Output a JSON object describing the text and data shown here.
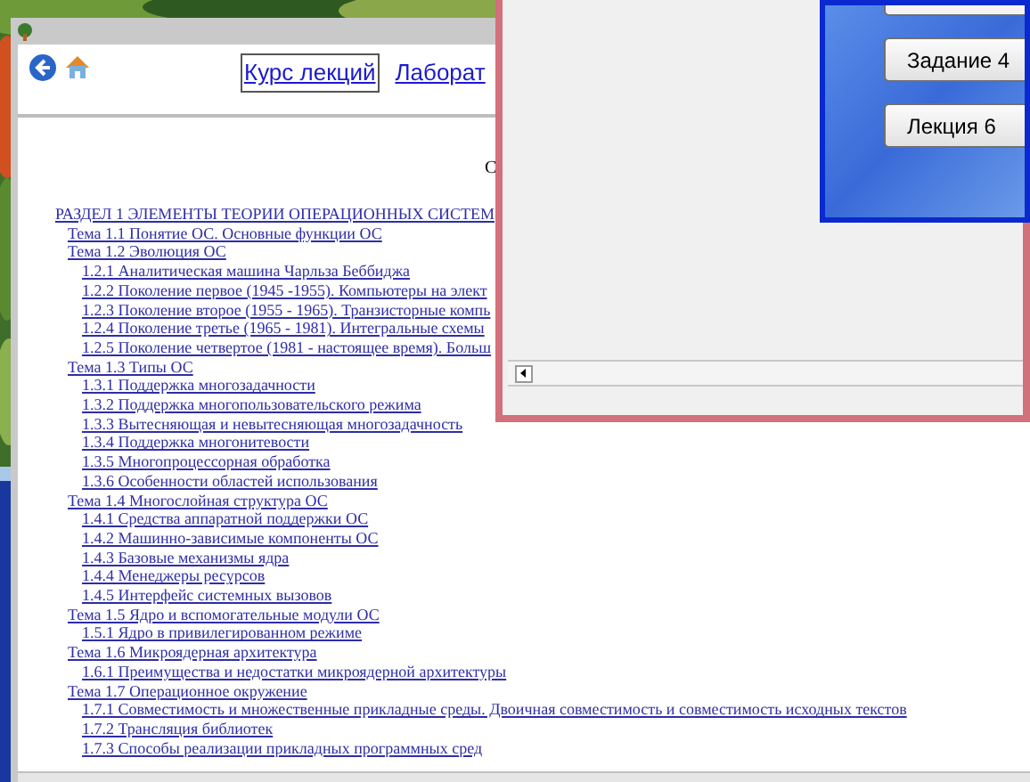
{
  "browser_window": {
    "nav_links": [
      {
        "label": "Курс лекций",
        "selected": true
      },
      {
        "label": "Лаборат",
        "selected": false
      }
    ],
    "heading": "С",
    "contents": [
      {
        "text": "РАЗДЕЛ 1 ЭЛЕМЕНТЫ ТЕОРИИ ОПЕРАЦИОННЫХ СИСТЕМ",
        "children": [
          {
            "text": "Тема 1.1 Понятие ОС. Основные функции ОС"
          },
          {
            "text": "Тема 1.2 Эволюция ОС",
            "children": [
              {
                "text": "1.2.1 Аналитическая машина Чарльза Беббиджа"
              },
              {
                "text": "1.2.2 Поколение первое (1945 -1955). Компьютеры на элект"
              },
              {
                "text": "1.2.3 Поколение второе (1955 - 1965). Транзисторные компь"
              },
              {
                "text": "1.2.4 Поколение третье (1965 - 1981). Интегральные схемы"
              },
              {
                "text": "1.2.5 Поколение четвертое (1981 - настоящее время). Больш"
              }
            ]
          },
          {
            "text": "Тема 1.3 Типы ОС",
            "children": [
              {
                "text": "1.3.1 Поддержка многозадачности"
              },
              {
                "text": "1.3.2 Поддержка многопользовательского режима"
              },
              {
                "text": "1.3.3 Вытесняющая и невытесняющая многозадачность"
              },
              {
                "text": "1.3.4 Поддержка многонитевости"
              },
              {
                "text": "1.3.5 Многопроцессорная обработка"
              },
              {
                "text": "1.3.6 Особенности областей использования"
              }
            ]
          },
          {
            "text": "Тема 1.4 Многослойная структура ОС",
            "children": [
              {
                "text": "1.4.1 Средства аппаратной поддержки ОС"
              },
              {
                "text": "1.4.2 Машинно-зависимые компоненты ОС"
              },
              {
                "text": "1.4.3 Базовые механизмы ядра"
              },
              {
                "text": "1.4.4 Менеджеры ресурсов"
              },
              {
                "text": "1.4.5 Интерфейс системных вызовов"
              }
            ]
          },
          {
            "text": "Тема 1.5 Ядро и вспомогательные модули ОС",
            "children": [
              {
                "text": "1.5.1 Ядро в привилегированном режиме"
              }
            ]
          },
          {
            "text": "Тема 1.6 Микроядерная архитектура",
            "children": [
              {
                "text": "1.6.1 Преимущества и недостатки микроядерной архитектуры"
              }
            ]
          },
          {
            "text": "Тема 1.7 Операционное окружение",
            "children": [
              {
                "text": "1.7.1 Совместимость и множественные прикладные среды. Двоичная совместимость и совместимость исходных текстов"
              },
              {
                "text": "1.7.2 Трансляция библиотек"
              },
              {
                "text": "1.7.3 Способы реализации прикладных программных сред"
              }
            ]
          }
        ]
      }
    ]
  },
  "dialog": {
    "buttons": [
      "Задание 4",
      "Лекция 6"
    ]
  }
}
